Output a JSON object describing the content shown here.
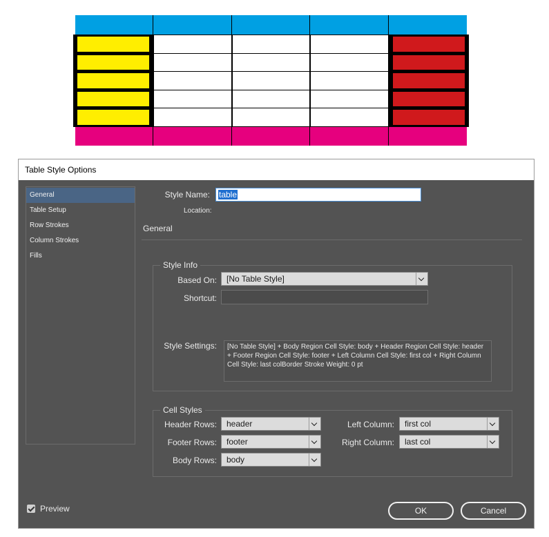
{
  "preview": {
    "colors": {
      "header": "#00a0e3",
      "footer": "#e6007e",
      "first_col": "#ffee00",
      "last_col": "#d0191c",
      "body": "#ffffff",
      "border": "#000000"
    },
    "columns": 5,
    "body_rows": 5
  },
  "dialog": {
    "title": "Table Style Options",
    "nav_items": [
      {
        "label": "General",
        "active": true
      },
      {
        "label": "Table Setup",
        "active": false
      },
      {
        "label": "Row Strokes",
        "active": false
      },
      {
        "label": "Column Strokes",
        "active": false
      },
      {
        "label": "Fills",
        "active": false
      }
    ],
    "style_name_label": "Style Name:",
    "style_name_value": "table",
    "location_label": "Location:",
    "section_title": "General",
    "style_info": {
      "title": "Style Info",
      "based_on_label": "Based On:",
      "based_on_value": "[No Table Style]",
      "shortcut_label": "Shortcut:",
      "shortcut_value": "",
      "settings_label": "Style Settings:",
      "settings_text": "[No Table Style] + Body Region Cell Style: body + Header Region Cell Style: header + Footer Region Cell Style: footer + Left Column Cell Style: first col + Right Column Cell Style: last colBorder Stroke Weight: 0 pt"
    },
    "cell_styles": {
      "title": "Cell Styles",
      "header_rows_label": "Header Rows:",
      "header_rows_value": "header",
      "footer_rows_label": "Footer Rows:",
      "footer_rows_value": "footer",
      "body_rows_label": "Body Rows:",
      "body_rows_value": "body",
      "left_column_label": "Left Column:",
      "left_column_value": "first col",
      "right_column_label": "Right Column:",
      "right_column_value": "last col"
    },
    "preview_label": "Preview",
    "preview_checked": true,
    "ok_label": "OK",
    "cancel_label": "Cancel"
  }
}
